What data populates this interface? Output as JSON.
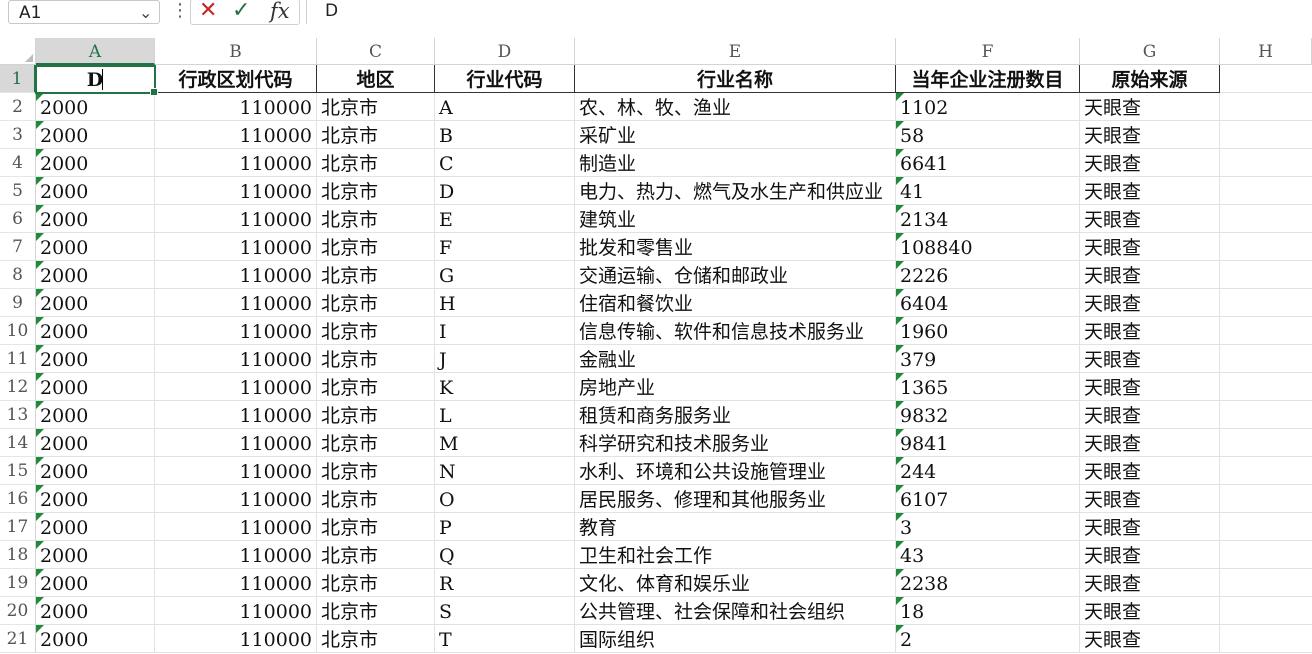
{
  "formula_bar": {
    "name_box": "A1",
    "formula_value": "D",
    "cancel_symbol": "✕",
    "confirm_symbol": "✓",
    "fx_symbol": "fx",
    "options_symbol": "⋮",
    "dropdown_symbol": "⌄"
  },
  "columns": [
    "A",
    "B",
    "C",
    "D",
    "E",
    "F",
    "G",
    "H"
  ],
  "rows": [
    "1",
    "2",
    "3",
    "4",
    "5",
    "6",
    "7",
    "8",
    "9",
    "10",
    "11",
    "12",
    "13",
    "14",
    "15",
    "16",
    "17",
    "18",
    "19",
    "20",
    "21"
  ],
  "header_row": [
    "D",
    "行政区划代码",
    "地区",
    "行业代码",
    "行业名称",
    "当年企业注册数目",
    "原始来源"
  ],
  "data_rows": [
    [
      "2000",
      "110000",
      "北京市",
      "A",
      "农、林、牧、渔业",
      "1102",
      "天眼查"
    ],
    [
      "2000",
      "110000",
      "北京市",
      "B",
      "采矿业",
      "58",
      "天眼查"
    ],
    [
      "2000",
      "110000",
      "北京市",
      "C",
      "制造业",
      "6641",
      "天眼查"
    ],
    [
      "2000",
      "110000",
      "北京市",
      "D",
      "电力、热力、燃气及水生产和供应业",
      "41",
      "天眼查"
    ],
    [
      "2000",
      "110000",
      "北京市",
      "E",
      "建筑业",
      "2134",
      "天眼查"
    ],
    [
      "2000",
      "110000",
      "北京市",
      "F",
      "批发和零售业",
      "108840",
      "天眼查"
    ],
    [
      "2000",
      "110000",
      "北京市",
      "G",
      "交通运输、仓储和邮政业",
      "2226",
      "天眼查"
    ],
    [
      "2000",
      "110000",
      "北京市",
      "H",
      "住宿和餐饮业",
      "6404",
      "天眼查"
    ],
    [
      "2000",
      "110000",
      "北京市",
      "I",
      "信息传输、软件和信息技术服务业",
      "1960",
      "天眼查"
    ],
    [
      "2000",
      "110000",
      "北京市",
      "J",
      "金融业",
      "379",
      "天眼查"
    ],
    [
      "2000",
      "110000",
      "北京市",
      "K",
      "房地产业",
      "1365",
      "天眼查"
    ],
    [
      "2000",
      "110000",
      "北京市",
      "L",
      "租赁和商务服务业",
      "9832",
      "天眼查"
    ],
    [
      "2000",
      "110000",
      "北京市",
      "M",
      "科学研究和技术服务业",
      "9841",
      "天眼查"
    ],
    [
      "2000",
      "110000",
      "北京市",
      "N",
      "水利、环境和公共设施管理业",
      "244",
      "天眼查"
    ],
    [
      "2000",
      "110000",
      "北京市",
      "O",
      "居民服务、修理和其他服务业",
      "6107",
      "天眼查"
    ],
    [
      "2000",
      "110000",
      "北京市",
      "P",
      "教育",
      "3",
      "天眼查"
    ],
    [
      "2000",
      "110000",
      "北京市",
      "Q",
      "卫生和社会工作",
      "43",
      "天眼查"
    ],
    [
      "2000",
      "110000",
      "北京市",
      "R",
      "文化、体育和娱乐业",
      "2238",
      "天眼查"
    ],
    [
      "2000",
      "110000",
      "北京市",
      "S",
      "公共管理、社会保障和社会组织",
      "18",
      "天眼查"
    ],
    [
      "2000",
      "110000",
      "北京市",
      "T",
      "国际组织",
      "2",
      "天眼查"
    ]
  ],
  "colors": {
    "accent": "#217346",
    "error_triangle": "#1e8a3a",
    "cancel": "#c62828"
  }
}
